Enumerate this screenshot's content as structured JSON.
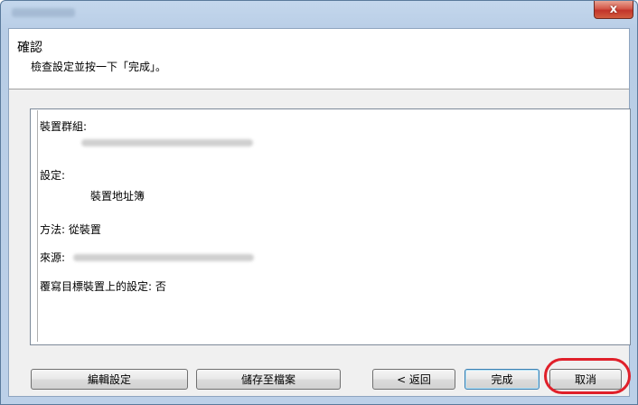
{
  "window": {
    "close_label": "x"
  },
  "header": {
    "title": "確認",
    "subtitle": "檢查設定並按一下「完成」。"
  },
  "details": {
    "device_group_label": "裝置群組:",
    "settings_label": "設定:",
    "settings_value": "裝置地址簿",
    "method_line": "方法: 從裝置",
    "source_label": "來源:",
    "overwrite_line": "覆寫目標裝置上的設定: 否"
  },
  "buttons": {
    "edit_settings": "編輯設定",
    "save_to_file": "儲存至檔案",
    "back": "< 返回",
    "finish": "完成",
    "cancel": "取消"
  }
}
